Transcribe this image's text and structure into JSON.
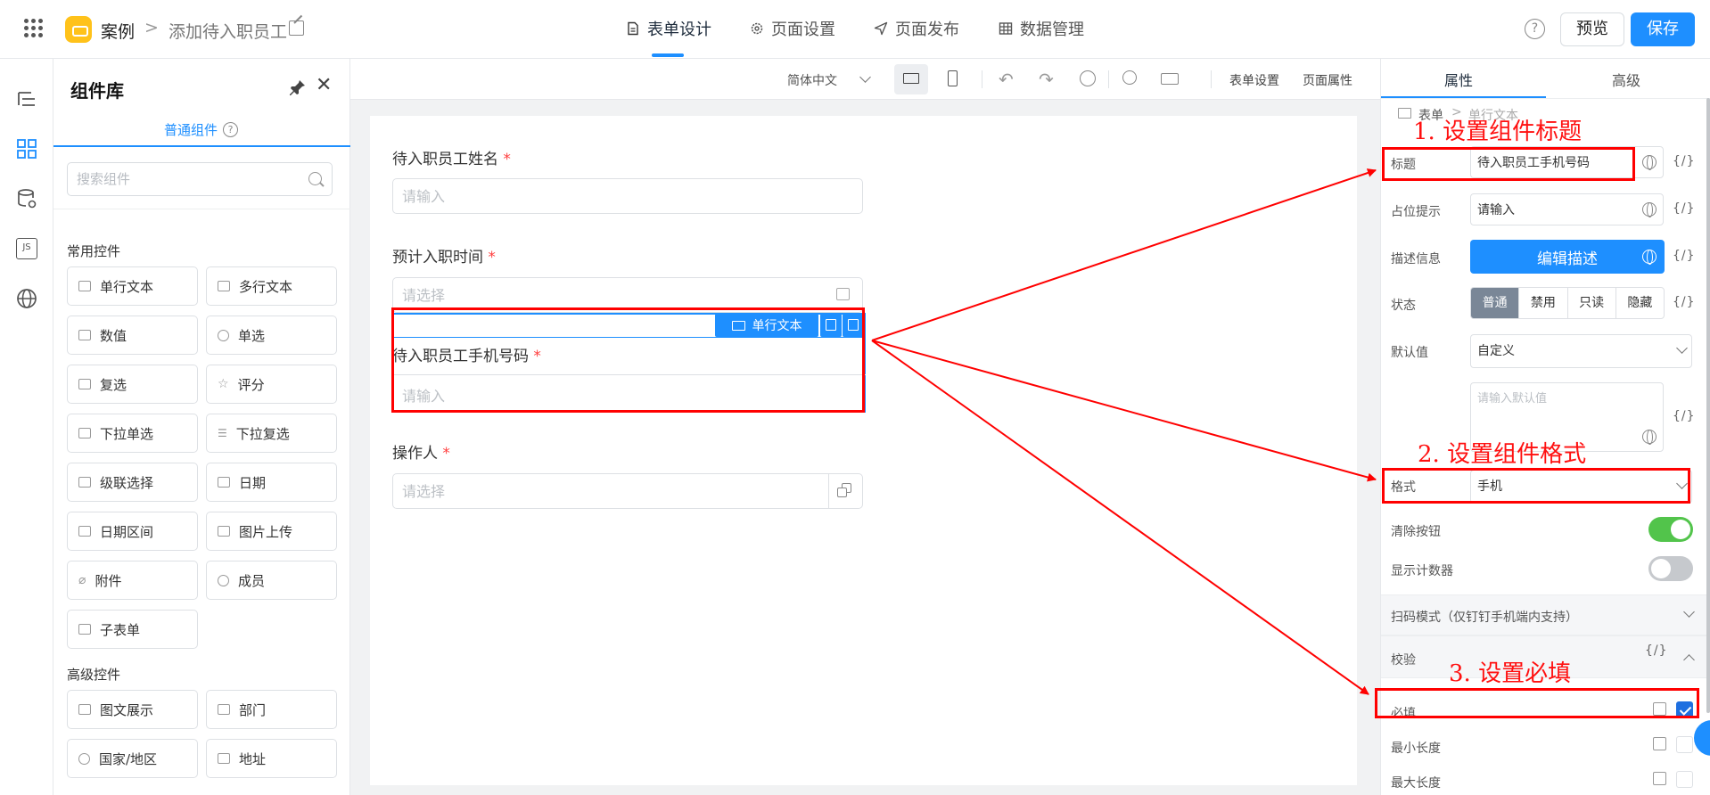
{
  "header": {
    "app_name": "案例",
    "breadcrumb_sep": ">",
    "page_name": "添加待入职员工",
    "tabs": [
      {
        "label": "表单设计",
        "icon": "document-icon"
      },
      {
        "label": "页面设置",
        "icon": "gear-icon"
      },
      {
        "label": "页面发布",
        "icon": "send-icon"
      },
      {
        "label": "数据管理",
        "icon": "table-icon"
      }
    ],
    "help": "?",
    "preview_label": "预览",
    "save_label": "保存",
    "colors": {
      "primary": "#1e8fff",
      "brand": "#ffc21a"
    }
  },
  "rail": {
    "items": [
      "outline-icon",
      "components-icon",
      "datasource-icon",
      "js-icon",
      "globe-icon"
    ],
    "js_label": "JS"
  },
  "library": {
    "title": "组件库",
    "tab_label": "普通组件",
    "search_placeholder": "搜索组件",
    "groups": [
      {
        "title": "常用控件",
        "items": [
          "单行文本",
          "多行文本",
          "数值",
          "单选",
          "复选",
          "评分",
          "下拉单选",
          "下拉复选",
          "级联选择",
          "日期",
          "日期区间",
          "图片上传",
          "附件",
          "成员",
          "子表单"
        ]
      },
      {
        "title": "高级控件",
        "items": [
          "图文展示",
          "部门",
          "国家/地区",
          "地址"
        ]
      }
    ]
  },
  "toolbar": {
    "language": "简体中文",
    "form_settings": "表单设置",
    "page_properties": "页面属性"
  },
  "canvas": {
    "fields": [
      {
        "label": "待入职员工姓名",
        "placeholder": "请输入",
        "required": "*"
      },
      {
        "label": "预计入职时间",
        "placeholder": "请选择",
        "required": "*"
      },
      {
        "label": "待入职员工手机号码",
        "placeholder": "请输入",
        "required": "*"
      },
      {
        "label": "操作人",
        "placeholder": "请选择",
        "required": "*"
      }
    ],
    "selected_badge": "单行文本"
  },
  "props": {
    "tabs": [
      "属性",
      "高级"
    ],
    "breadcrumb": {
      "form": "表单",
      "sep": ">",
      "component": "单行文本"
    },
    "title_label": "标题",
    "title_value": "待入职员工手机号码",
    "placeholder_label": "占位提示",
    "placeholder_value": "请输入",
    "desc_label": "描述信息",
    "desc_button": "编辑描述",
    "state_label": "状态",
    "state_options": [
      "普通",
      "禁用",
      "只读",
      "隐藏"
    ],
    "default_label": "默认值",
    "default_mode": "自定义",
    "default_placeholder": "请输入默认值",
    "format_label": "格式",
    "format_value": "手机",
    "clear_label": "清除按钮",
    "counter_label": "显示计数器",
    "scan_section": "扫码模式（仅钉钉手机端内支持）",
    "validate_section": "校验",
    "required_label": "必填",
    "min_label": "最小长度",
    "max_label": "最大长度",
    "expr_symbol": "{/}",
    "clear_enabled": 1,
    "counter_enabled": 0,
    "required_checked": 1
  },
  "annotations": {
    "step1": "1. 设置组件标题",
    "step2": "2. 设置组件格式",
    "step3": "3. 设置必填",
    "color": "#ff0000"
  }
}
